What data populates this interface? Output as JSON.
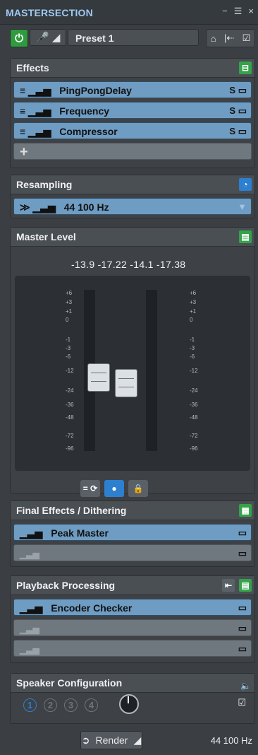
{
  "title_bar": {
    "title": "MASTERSECTION",
    "icons": [
      "minimize-icon",
      "list-icon",
      "close-icon"
    ]
  },
  "top_row": {
    "preset": "Preset 1",
    "icons": [
      "power-icon",
      "mic-icon",
      "preset-menu-icon",
      "load-icon",
      "save-icon",
      "check-icon"
    ]
  },
  "effects": {
    "title": "Effects",
    "items": [
      "PingPongDelay",
      "Frequency",
      "Compressor"
    ],
    "add": "+"
  },
  "resampling": {
    "title": "Resampling",
    "value": "44 100 Hz"
  },
  "master_level": {
    "title": "Master Level",
    "readout": "-13.9 -17.22  -14.1 -17.38",
    "left_scale": [
      "+6",
      "+3",
      "+1",
      "0",
      "-1",
      "-3",
      "-6",
      "-12",
      "-24",
      "-36",
      "-48",
      "-72",
      "-96"
    ],
    "right_scale": [
      "+6",
      "+3",
      "+1",
      "0",
      "-1",
      "-3",
      "-6",
      "-12",
      "-24",
      "-36",
      "-48",
      "-72",
      "-96"
    ]
  },
  "final_effects": {
    "title": "Final Effects / Dithering",
    "items": [
      "Peak Master"
    ]
  },
  "playback": {
    "title": "Playback Processing",
    "items": [
      "Encoder Checker"
    ]
  },
  "speaker": {
    "title": "Speaker Configuration",
    "numbers": [
      "1",
      "2",
      "3",
      "4"
    ]
  },
  "footer": {
    "render": "Render",
    "rate": "44 100 Hz"
  }
}
